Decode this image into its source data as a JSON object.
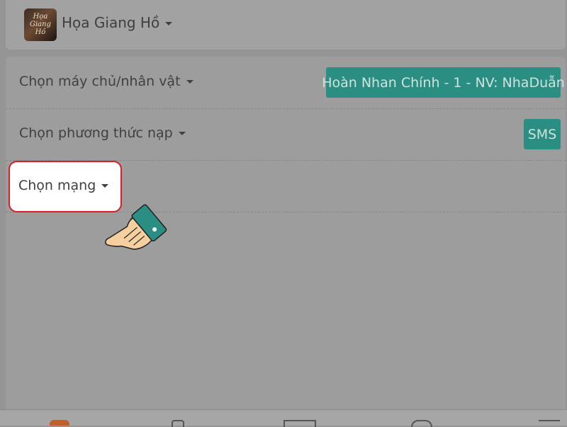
{
  "header": {
    "logo_icon": "game-logo",
    "logo_text": "Họa Giang Hồ",
    "title": "Họa Giang Hồ"
  },
  "rows": {
    "server": {
      "label": "Chọn máy chủ/nhân vật",
      "selected": "Hoàn Nhan Chính - 1 - NV: NhaDuẫn"
    },
    "payment_method": {
      "label": "Chọn phương thức nạp",
      "selected": "SMS"
    },
    "network": {
      "label": "Chọn mạng"
    }
  },
  "colors": {
    "accent": "#2a8f82",
    "highlight_border": "#d81e26",
    "overlay_bg": "#959595"
  },
  "bottom_nav": [
    "home-icon",
    "bottle-icon",
    "card-icon",
    "support-icon",
    "menu-icon"
  ]
}
